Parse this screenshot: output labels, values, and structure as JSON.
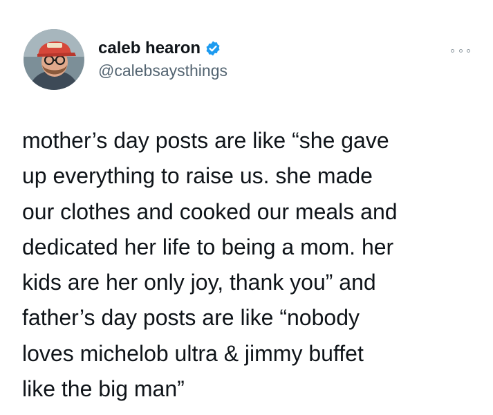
{
  "author": {
    "display_name": "caleb hearon",
    "handle": "@calebsaysthings",
    "verified": true,
    "avatar_icon": "profile-photo-avatar"
  },
  "menu": {
    "icon": "more-options-icon"
  },
  "tweet": {
    "lines": [
      "mother’s day posts are like “she gave",
      "up everything to raise us. she made",
      "our clothes and cooked our meals and",
      "dedicated her life to being a mom. her",
      "kids are her only joy, thank you” and",
      "father’s day posts are like “nobody",
      "loves michelob ultra & jimmy buffet",
      "like the big man”"
    ]
  },
  "colors": {
    "text": "#0f1419",
    "secondary": "#536471",
    "verified_blue": "#1d9bf0",
    "background": "#ffffff"
  }
}
